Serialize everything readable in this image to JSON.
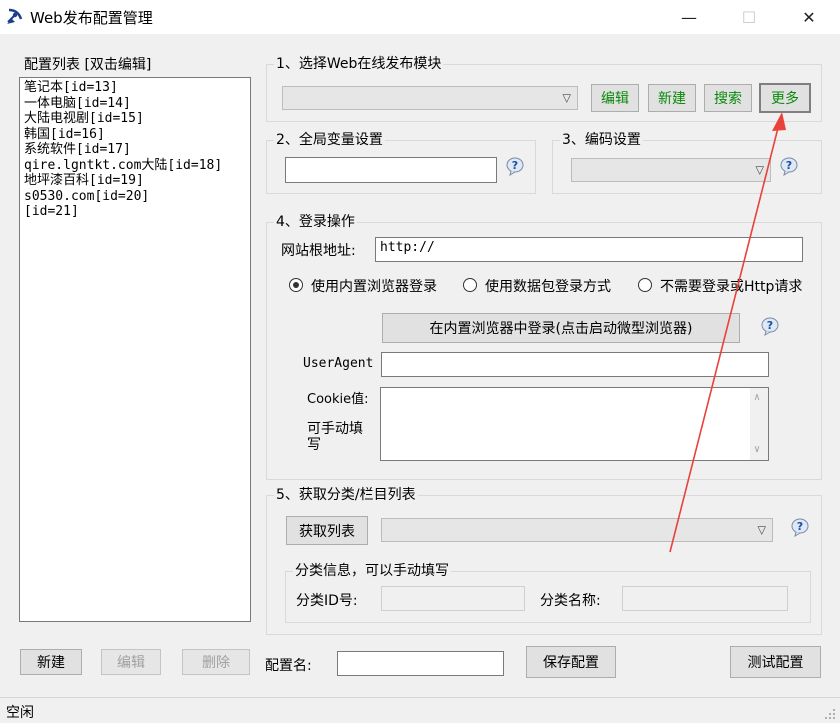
{
  "window": {
    "title": "Web发布配置管理",
    "minimize": "—",
    "maximize": "☐",
    "close": "✕"
  },
  "config_list": {
    "label": "配置列表 [双击编辑]",
    "items": [
      "笔记本[id=13]",
      "一体电脑[id=14]",
      "大陆电视剧[id=15]",
      "韩国[id=16]",
      "系统软件[id=17]",
      "qire.lgntkt.com大陆[id=18]",
      "地坪漆百科[id=19]",
      "s0530.com[id=20]",
      "[id=21]"
    ]
  },
  "section1": {
    "label": "1、选择Web在线发布模块",
    "edit_button": "编辑",
    "new_button": "新建",
    "search_button": "搜索",
    "more_button": "更多"
  },
  "section2": {
    "label": "2、全局变量设置"
  },
  "section3": {
    "label": "3、编码设置"
  },
  "section4": {
    "label": "4、登录操作",
    "site_root_label": "网站根地址:",
    "site_root_value": "http://",
    "radio_builtin": "使用内置浏览器登录",
    "radio_packet": "使用数据包登录方式",
    "radio_none": "不需要登录或Http请求",
    "login_button": "在内置浏览器中登录(点击启动微型浏览器)",
    "useragent_label": "UserAgent",
    "cookie_label": "Cookie值:",
    "cookie_hint": "可手动填写"
  },
  "section5": {
    "label": "5、获取分类/栏目列表",
    "fetch_button": "获取列表",
    "category_info_label": "分类信息，可以手动填写",
    "category_id_label": "分类ID号:",
    "category_name_label": "分类名称:"
  },
  "bottom": {
    "new_button": "新建",
    "edit_button": "编辑",
    "delete_button": "删除",
    "config_name_label": "配置名:",
    "save_button": "保存配置",
    "test_button": "测试配置"
  },
  "status": {
    "text": "空闲"
  },
  "colors": {
    "annotation_arrow": "#e8423a",
    "button_green": "#0a8a0a"
  }
}
